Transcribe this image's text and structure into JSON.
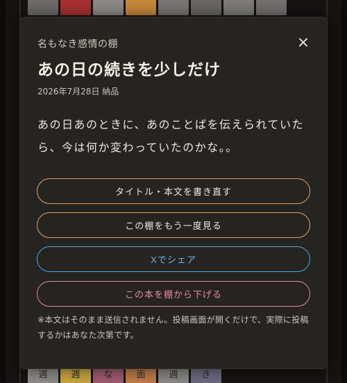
{
  "modal": {
    "shelf_name": "名もなき感情の棚",
    "title": "あの日の続きを少しだけ",
    "meta": "2026年7月28日 納品",
    "body": "あの日あのときに、あのことばを伝えられていたら、今は何か変わっていたのかな。。",
    "close_icon": "×",
    "buttons": {
      "edit": "タイトル・本文を書き直す",
      "view_shelf": "この棚をもう一度見る",
      "share": "Xでシェア",
      "remove": "この本を棚から下げる"
    },
    "note": "※本文はそのまま送信されません。投稿画面が開くだけで、実際に投稿するかはあなた次第です。"
  },
  "background": {
    "bottom_spines": [
      "週",
      "週",
      "な",
      "面",
      "週",
      "き"
    ]
  },
  "colors": {
    "accent_orange": "#e6a45a",
    "share_blue": "#4fa6e6",
    "remove_pink": "#e88aa0"
  }
}
